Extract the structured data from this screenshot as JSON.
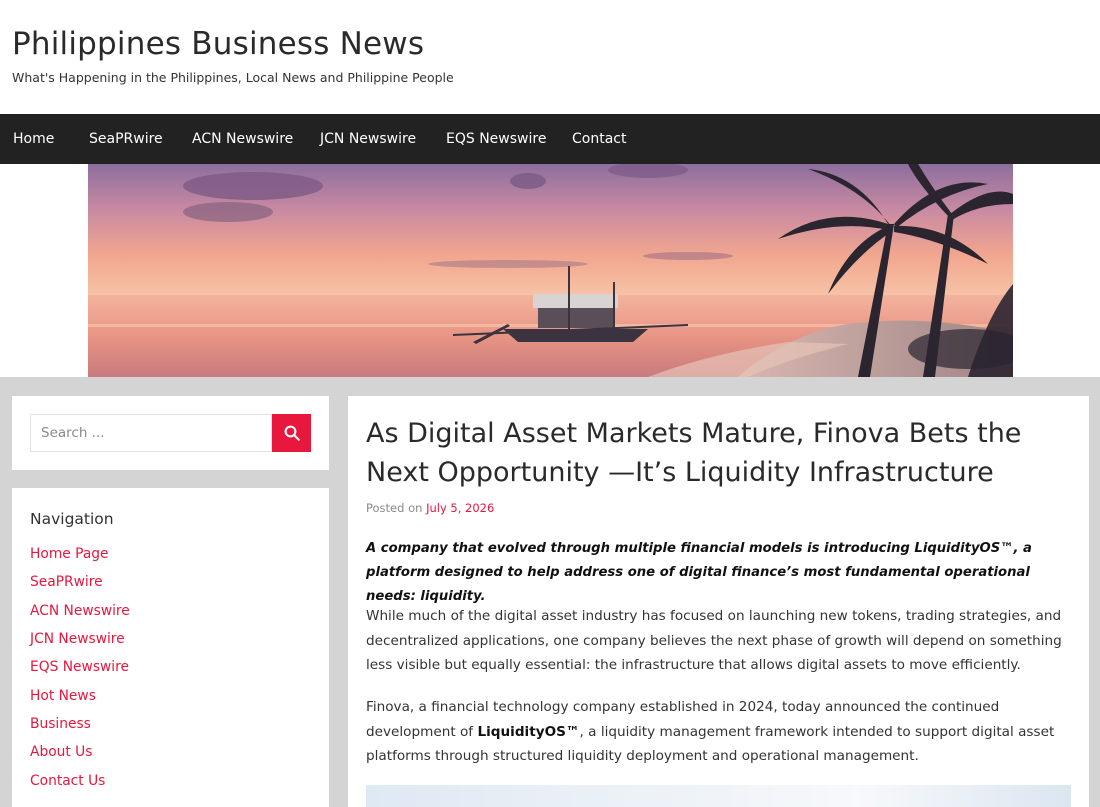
{
  "header": {
    "site_title": "Philippines Business News",
    "tagline": "What's Happening in the Philippines, Local News and Philippine People"
  },
  "main_nav": {
    "items": [
      {
        "label": "Home"
      },
      {
        "label": "SeaPRwire"
      },
      {
        "label": "ACN Newswire"
      },
      {
        "label": "JCN Newswire"
      },
      {
        "label": "EQS Newswire"
      },
      {
        "label": "Contact"
      }
    ]
  },
  "sidebar": {
    "search": {
      "placeholder": "Search ...",
      "icon": "search-icon"
    },
    "navigation": {
      "title": "Navigation",
      "items": [
        {
          "label": "Home Page"
        },
        {
          "label": "SeaPRwire"
        },
        {
          "label": "ACN Newswire"
        },
        {
          "label": "JCN Newswire"
        },
        {
          "label": "EQS Newswire"
        },
        {
          "label": "Hot News"
        },
        {
          "label": "Business"
        },
        {
          "label": "About Us"
        },
        {
          "label": "Contact Us"
        }
      ]
    }
  },
  "article": {
    "title": "As Digital Asset Markets Mature, Finova Bets the Next Opportunity —It’s Liquidity Infrastructure",
    "meta_prefix": "Posted on",
    "date": "July 5, 2026",
    "lead": "A company that evolved through multiple financial models is introducing LiquidityOS™, a platform designed to help address one of digital finance’s most fundamental operational needs: liquidity.",
    "paragraph_1": "While much of the digital asset industry has focused on launching new tokens, trading strategies, and decentralized applications, one company believes the next phase of growth will depend on something less visible but equally essential: the infrastructure that allows digital assets to move efficiently.",
    "paragraph_2_start": "Finova, a financial technology company established in 2024, today announced the continued development of",
    "paragraph_2_strong": "LiquidityOS™",
    "paragraph_2_end": ", a liquidity management framework intended to support digital asset platforms through structured liquidity deployment and operational management."
  },
  "colors": {
    "accent": "#e8173d",
    "nav_background": "#222222",
    "page_background": "#d4d4d4"
  }
}
